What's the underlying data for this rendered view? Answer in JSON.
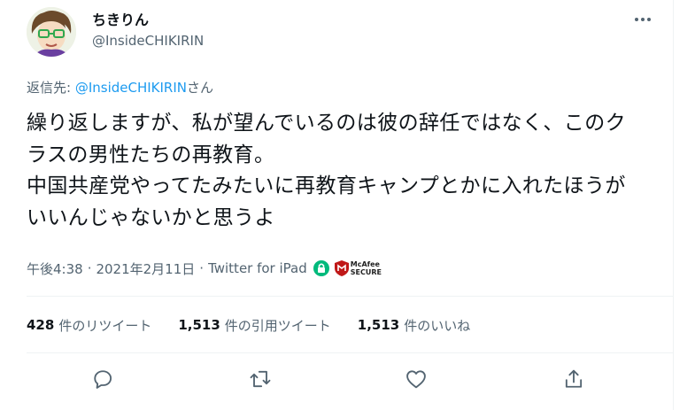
{
  "user": {
    "display_name": "ちきりん",
    "handle": "@InsideCHIKIRIN"
  },
  "reply": {
    "prefix": "返信先: ",
    "mention": "@InsideCHIKIRIN",
    "suffix": "さん"
  },
  "tweet": {
    "text": "繰り返しますが、私が望んでいるのは彼の辞任ではなく、このクラスの男性たちの再教育。\n中国共産党やってたみたいに再教育キャンプとかに入れたほうがいいんじゃないかと思うよ",
    "time": "午後4:38",
    "date": "2021年2月11日",
    "separator": "·",
    "source": "Twitter for iPad",
    "badge_line1": "McAfee",
    "badge_line2": "SECURE"
  },
  "stats": {
    "retweets_count": "428",
    "retweets_label": "件のリツイート",
    "quotes_count": "1,513",
    "quotes_label": "件の引用ツイート",
    "likes_count": "1,513",
    "likes_label": "件のいいね"
  },
  "icons": {
    "more": "more-horizontal-icon",
    "lock": "lock-icon",
    "mcafee": "mcafee-shield-icon",
    "reply": "reply-icon",
    "retweet": "retweet-icon",
    "like": "heart-icon",
    "share": "share-icon"
  },
  "colors": {
    "text": "#0f1419",
    "secondary": "#536471",
    "accent": "#1d9bf0",
    "lock_green": "#00ba7c",
    "mcafee_red": "#c01818",
    "divider": "#eff3f4"
  }
}
